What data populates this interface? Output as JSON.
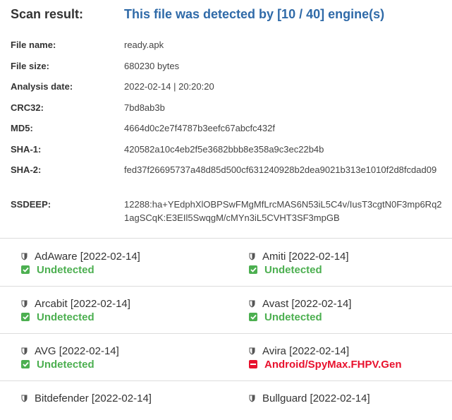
{
  "header": {
    "label": "Scan result:",
    "value": "This file was detected by [10 / 40] engine(s)"
  },
  "file_info": [
    {
      "label": "File name:",
      "value": "ready.apk"
    },
    {
      "label": "File size:",
      "value": "680230 bytes"
    },
    {
      "label": "Analysis date:",
      "value": "2022-02-14 | 20:20:20"
    },
    {
      "label": "CRC32:",
      "value": "7bd8ab3b"
    },
    {
      "label": "MD5:",
      "value": "4664d0c2e7f4787b3eefc67abcfc432f"
    },
    {
      "label": "SHA-1:",
      "value": "420582a10c4eb2f5e3682bbb8e358a9c3ec22b4b"
    },
    {
      "label": "SHA-2:",
      "value": "fed37f26695737a48d85d500cf631240928b2dea9021b313e1010f2d8fcdad09"
    },
    {
      "label": "SSDEEP:",
      "value": "12288:ha+YEdphXlOBPSwFMgMfLrcMAS6N53iL5C4v/IusT3cgtN0F3mp6Rq21agSCqK:E3EIl5SwqgM/cMYn3iL5CVHT3SF3mpGB"
    }
  ],
  "engines": [
    {
      "name": "AdAware [2022-02-14]",
      "status": "Undetected",
      "detected": false
    },
    {
      "name": "Amiti [2022-02-14]",
      "status": "Undetected",
      "detected": false
    },
    {
      "name": "Arcabit [2022-02-14]",
      "status": "Undetected",
      "detected": false
    },
    {
      "name": "Avast [2022-02-14]",
      "status": "Undetected",
      "detected": false
    },
    {
      "name": "AVG [2022-02-14]",
      "status": "Undetected",
      "detected": false
    },
    {
      "name": "Avira [2022-02-14]",
      "status": "Android/SpyMax.FHPV.Gen",
      "detected": true
    },
    {
      "name": "Bitdefender [2022-02-14]",
      "status": "",
      "detected": false
    },
    {
      "name": "Bullguard [2022-02-14]",
      "status": "",
      "detected": false
    }
  ],
  "colors": {
    "accent": "#2f6aa8",
    "undetected": "#4caf50",
    "detected": "#e8112d"
  },
  "icons": {
    "engine": "shield-icon",
    "undetected": "check-icon",
    "detected": "minus-icon"
  }
}
